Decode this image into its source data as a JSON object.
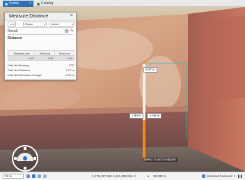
{
  "tabs": [
    {
      "label": "Scene",
      "active": true,
      "close": "×"
    },
    {
      "label": "Catalog",
      "active": false
    }
  ],
  "panel": {
    "title": "Measure Distance",
    "close": "×",
    "mode_value": "Planar",
    "units_value": "Metric",
    "result_label": "Result",
    "distance_label": "Distance",
    "table_headers": [
      "Segment (m)",
      "Path (m)",
      "Sum (m)"
    ],
    "table_row": [
      "1.90",
      "1.90",
      "1.90"
    ],
    "stats": [
      {
        "label": "Path Net Bearing:",
        "value": "273°"
      },
      {
        "label": "Path Net Distance:",
        "value": "0.07 m"
      },
      {
        "label": "Path Net Elevation Change:",
        "value": "-1.90 m"
      }
    ]
  },
  "measure": {
    "top_label": "0.07 m",
    "left_label": "1.90 m",
    "right_label": "-1.90 m",
    "hint": "Select to pick Endpoint"
  },
  "status": {
    "scale": "29 m",
    "coordinates": "2,479,427.665 4,511,382.844 m",
    "elevation": "33.833 m",
    "selected": "Selected Features: 1"
  },
  "colors": {
    "accent": "#2f6fb6",
    "measure_line": "#f28a1e",
    "guide_line": "#39b7b2"
  }
}
